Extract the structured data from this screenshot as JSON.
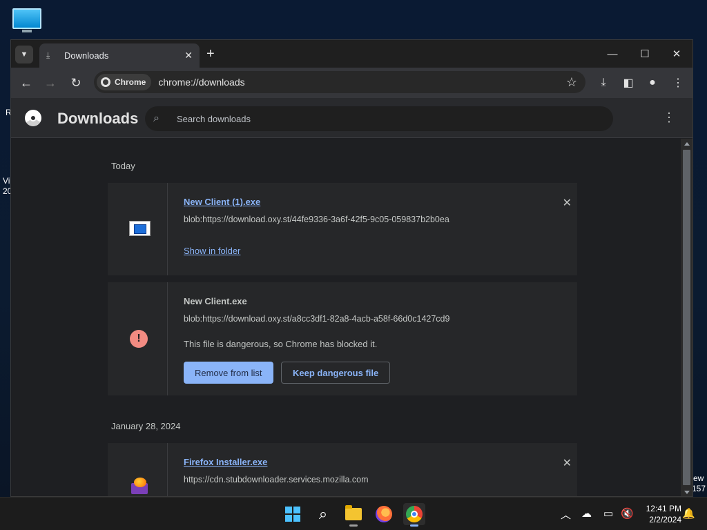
{
  "desktop": {
    "edge_texts": [
      "R",
      "Vi",
      "20",
      "ew",
      "157"
    ]
  },
  "window": {
    "tab": {
      "title": "Downloads",
      "close": "✕"
    },
    "new_tab": "+",
    "controls": {
      "minimize": "—",
      "maximize": "☐",
      "close": "✕"
    }
  },
  "toolbar": {
    "chip_label": "Chrome",
    "url": "chrome://downloads"
  },
  "page": {
    "title": "Downloads",
    "search_placeholder": "Search downloads"
  },
  "groups": [
    {
      "date": "Today",
      "items": [
        {
          "filename": "New Client (1).exe",
          "url": "blob:https://download.oxy.st/44fe9336-3a6f-42f5-9c05-059837b2b0ea",
          "action_link": "Show in folder"
        },
        {
          "filename": "New Client.exe",
          "url": "blob:https://download.oxy.st/a8cc3df1-82a8-4acb-a58f-66d0c1427cd9",
          "warning": "This file is dangerous, so Chrome has blocked it.",
          "primary_button": "Remove from list",
          "secondary_button": "Keep dangerous file"
        }
      ]
    },
    {
      "date": "January 28, 2024",
      "items": [
        {
          "filename": "Firefox Installer.exe",
          "url": "https://cdn.stubdownloader.services.mozilla.com"
        }
      ]
    }
  ],
  "taskbar": {
    "time": "12:41 PM",
    "date": "2/2/2024"
  },
  "colors": {
    "link_blue": "#8ab4f8",
    "danger_red": "#f28b82",
    "page_bg": "#1e1f22"
  }
}
